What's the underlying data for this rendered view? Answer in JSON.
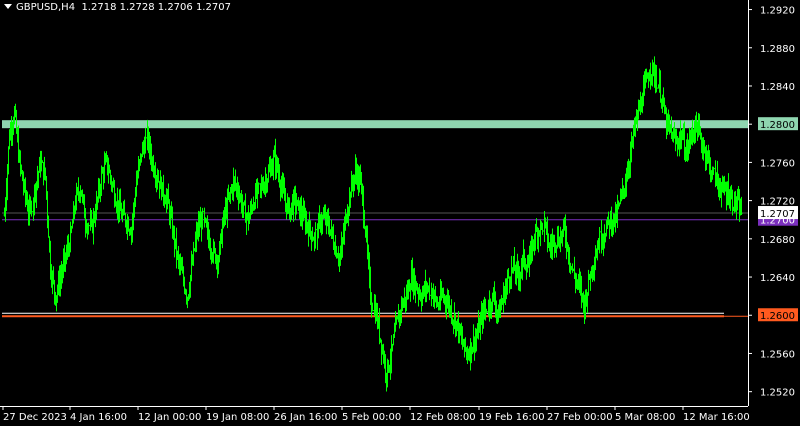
{
  "symbol_header": {
    "symbol_timeframe": "GBPUSD,H4",
    "ohlc": "1.2718 1.2728 1.2706 1.2707"
  },
  "chart_data": {
    "type": "bar",
    "symbol": "GBPUSD",
    "timeframe": "H4",
    "last_price": "1.2707",
    "price_axis_ticks": [
      "1.2920",
      "1.2880",
      "1.2840",
      "1.2800",
      "1.2760",
      "1.2720",
      "1.2680",
      "1.2640",
      "1.2600",
      "1.2560",
      "1.2520"
    ],
    "time_axis_labels": [
      "27 Dec 2023",
      "4 Jan 16:00",
      "12 Jan 00:00",
      "19 Jan 08:00",
      "26 Jan 16:00",
      "5 Feb 00:00",
      "12 Feb 08:00",
      "19 Feb 16:00",
      "27 Feb 00:00",
      "5 Mar 08:00",
      "12 Mar 16:00"
    ],
    "ylim": [
      1.2505,
      1.293
    ],
    "horizontal_levels": [
      {
        "price": 1.28,
        "label": "1.2800",
        "color": "#8fd6b0",
        "style": "zone"
      },
      {
        "price": 1.27,
        "label": "1.2700",
        "color": "#7b2fbe",
        "style": "line"
      },
      {
        "price": 1.26,
        "label": "1.2600",
        "color": "#ff5a1f",
        "style": "double"
      }
    ],
    "close_series": [
      1.2705,
      1.279,
      1.2812,
      1.276,
      1.273,
      1.2705,
      1.2735,
      1.276,
      1.2745,
      1.265,
      1.262,
      1.264,
      1.266,
      1.268,
      1.272,
      1.2735,
      1.27,
      1.269,
      1.2715,
      1.2745,
      1.276,
      1.274,
      1.272,
      1.2705,
      1.27,
      1.269,
      1.274,
      1.277,
      1.2785,
      1.276,
      1.2745,
      1.273,
      1.272,
      1.269,
      1.266,
      1.264,
      1.262,
      1.2655,
      1.269,
      1.27,
      1.268,
      1.2665,
      1.266,
      1.27,
      1.272,
      1.274,
      1.273,
      1.271,
      1.27,
      1.272,
      1.273,
      1.274,
      1.275,
      1.2765,
      1.2745,
      1.272,
      1.271,
      1.272,
      1.271,
      1.27,
      1.269,
      1.268,
      1.27,
      1.27,
      1.269,
      1.267,
      1.266,
      1.27,
      1.273,
      1.275,
      1.274,
      1.269,
      1.262,
      1.26,
      1.257,
      1.254,
      1.256,
      1.259,
      1.261,
      1.262,
      1.264,
      1.263,
      1.262,
      1.263,
      1.2625,
      1.261,
      1.262,
      1.2615,
      1.26,
      1.259,
      1.257,
      1.256,
      1.257,
      1.258,
      1.26,
      1.261,
      1.262,
      1.26,
      1.262,
      1.264,
      1.265,
      1.264,
      1.266,
      1.265,
      1.268,
      1.269,
      1.2695,
      1.267,
      1.268,
      1.268,
      1.269,
      1.266,
      1.264,
      1.263,
      1.261,
      1.264,
      1.266,
      1.268,
      1.269,
      1.27,
      1.27,
      1.272,
      1.274,
      1.277,
      1.28,
      1.282,
      1.284,
      1.286,
      1.285,
      1.283,
      1.28,
      1.279,
      1.278,
      1.279,
      1.277,
      1.279,
      1.28,
      1.278,
      1.277,
      1.275,
      1.274,
      1.273,
      1.273,
      1.272,
      1.2715,
      1.2707
    ]
  }
}
